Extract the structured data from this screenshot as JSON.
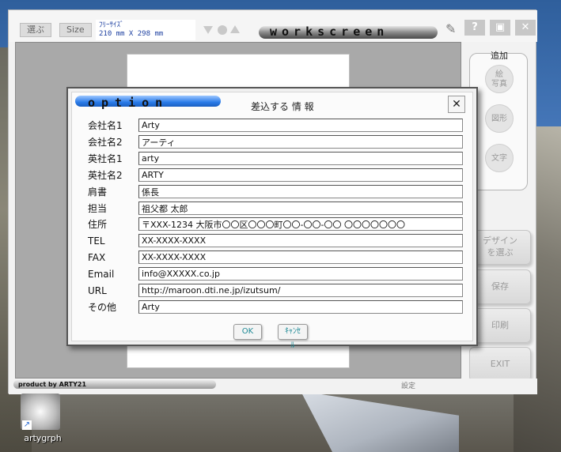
{
  "toolbar": {
    "select_label": "選ぶ",
    "size_label": "Size",
    "size_name": "ﾌﾘｰｻｲｽﾞ",
    "size_dims": "210 mm X 298 mm",
    "workscreen_label": "workscreen",
    "help_label": "?"
  },
  "side_panel": {
    "title": "追加",
    "photo_label": "絵 写真",
    "photo_line1": "絵",
    "photo_line2": "写真",
    "shape_label": "図形",
    "text_label": "文字"
  },
  "actions": {
    "design_line1": "デザイン",
    "design_line2": "を選ぶ",
    "save_label": "保存",
    "print_label": "印刷",
    "exit_label": "EXIT"
  },
  "status": {
    "product": "product by ARTY21",
    "settings": "設定"
  },
  "dialog": {
    "banner": "option",
    "title": "差込する 情 報",
    "fields": [
      {
        "label": "会社名1",
        "value": "Arty"
      },
      {
        "label": "会社名2",
        "value": "アーティ"
      },
      {
        "label": "英社名1",
        "value": "arty"
      },
      {
        "label": "英社名2",
        "value": "ARTY"
      },
      {
        "label": "肩書",
        "value": "係長"
      },
      {
        "label": "担当",
        "value": "祖父都 太郎"
      },
      {
        "label": "住所",
        "value": "〒XXX-1234 大阪市〇〇区〇〇〇町〇〇-〇〇-〇〇 〇〇〇〇〇〇〇"
      },
      {
        "label": "TEL",
        "value": "XX-XXXX-XXXX"
      },
      {
        "label": "FAX",
        "value": "XX-XXXX-XXXX"
      },
      {
        "label": "Email",
        "value": "info@XXXXX.co.jp"
      },
      {
        "label": "URL",
        "value": "http://maroon.dti.ne.jp/izutsum/"
      },
      {
        "label": "その他",
        "value": "Arty"
      }
    ],
    "ok_label": "OK",
    "cancel_label": "ｷｬﾝｾﾙ"
  },
  "desktop": {
    "icon_label": "artygrph"
  }
}
